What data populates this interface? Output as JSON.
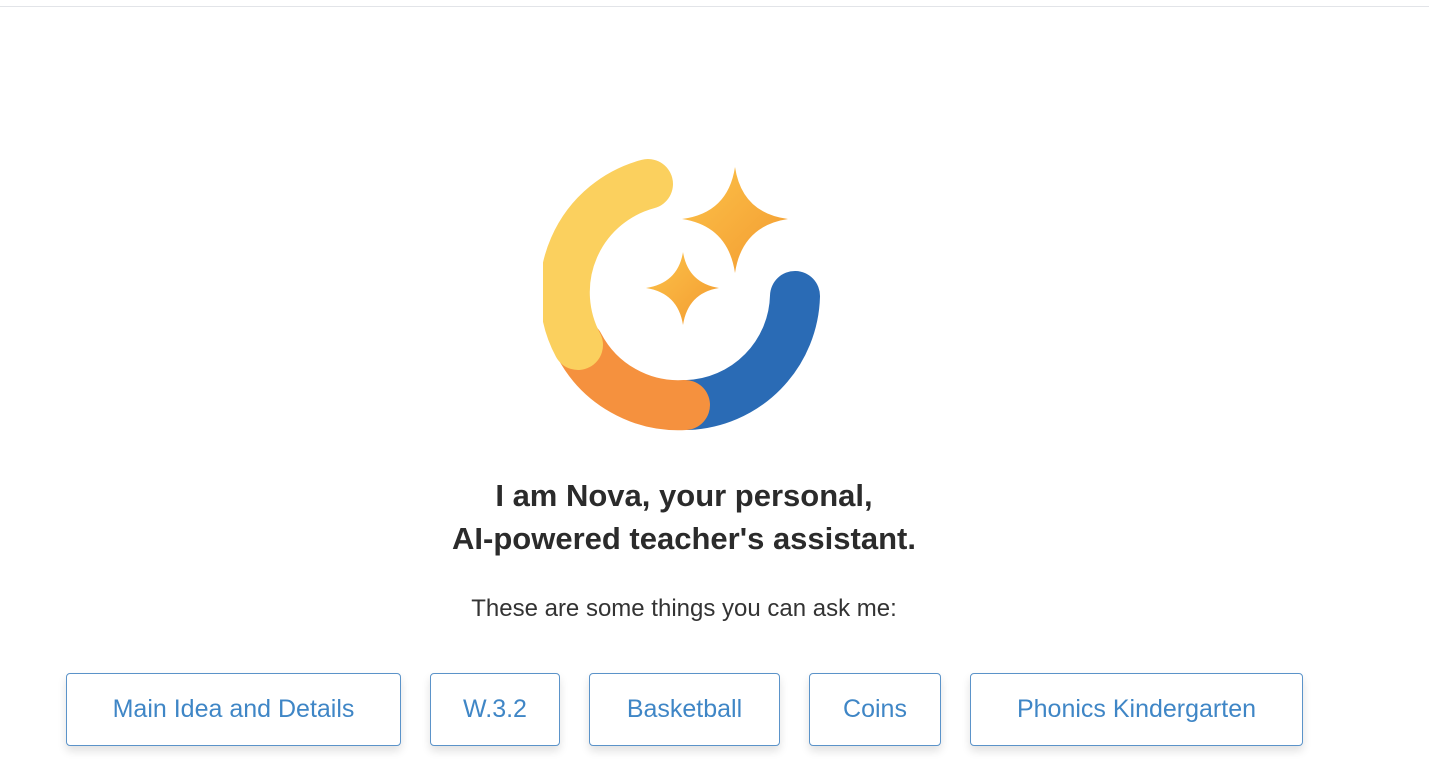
{
  "heading": {
    "line1": "I am Nova, your personal,",
    "line2": "AI-powered teacher's assistant."
  },
  "subheading": "These are some things you can ask me:",
  "suggestions": [
    "Main Idea and Details",
    "W.3.2",
    "Basketball",
    "Coins",
    "Phonics Kindergarten"
  ],
  "logo": {
    "icon": "nova-logo-icon",
    "colors": {
      "yellow": "#fbd05e",
      "orange": "#f5913e",
      "blue": "#2a6bb5",
      "sparkle": "#f7a83a"
    }
  },
  "colors": {
    "chip_text": "#3f86c6",
    "chip_border": "#5b93c9",
    "heading_text": "#2b2b2b"
  }
}
